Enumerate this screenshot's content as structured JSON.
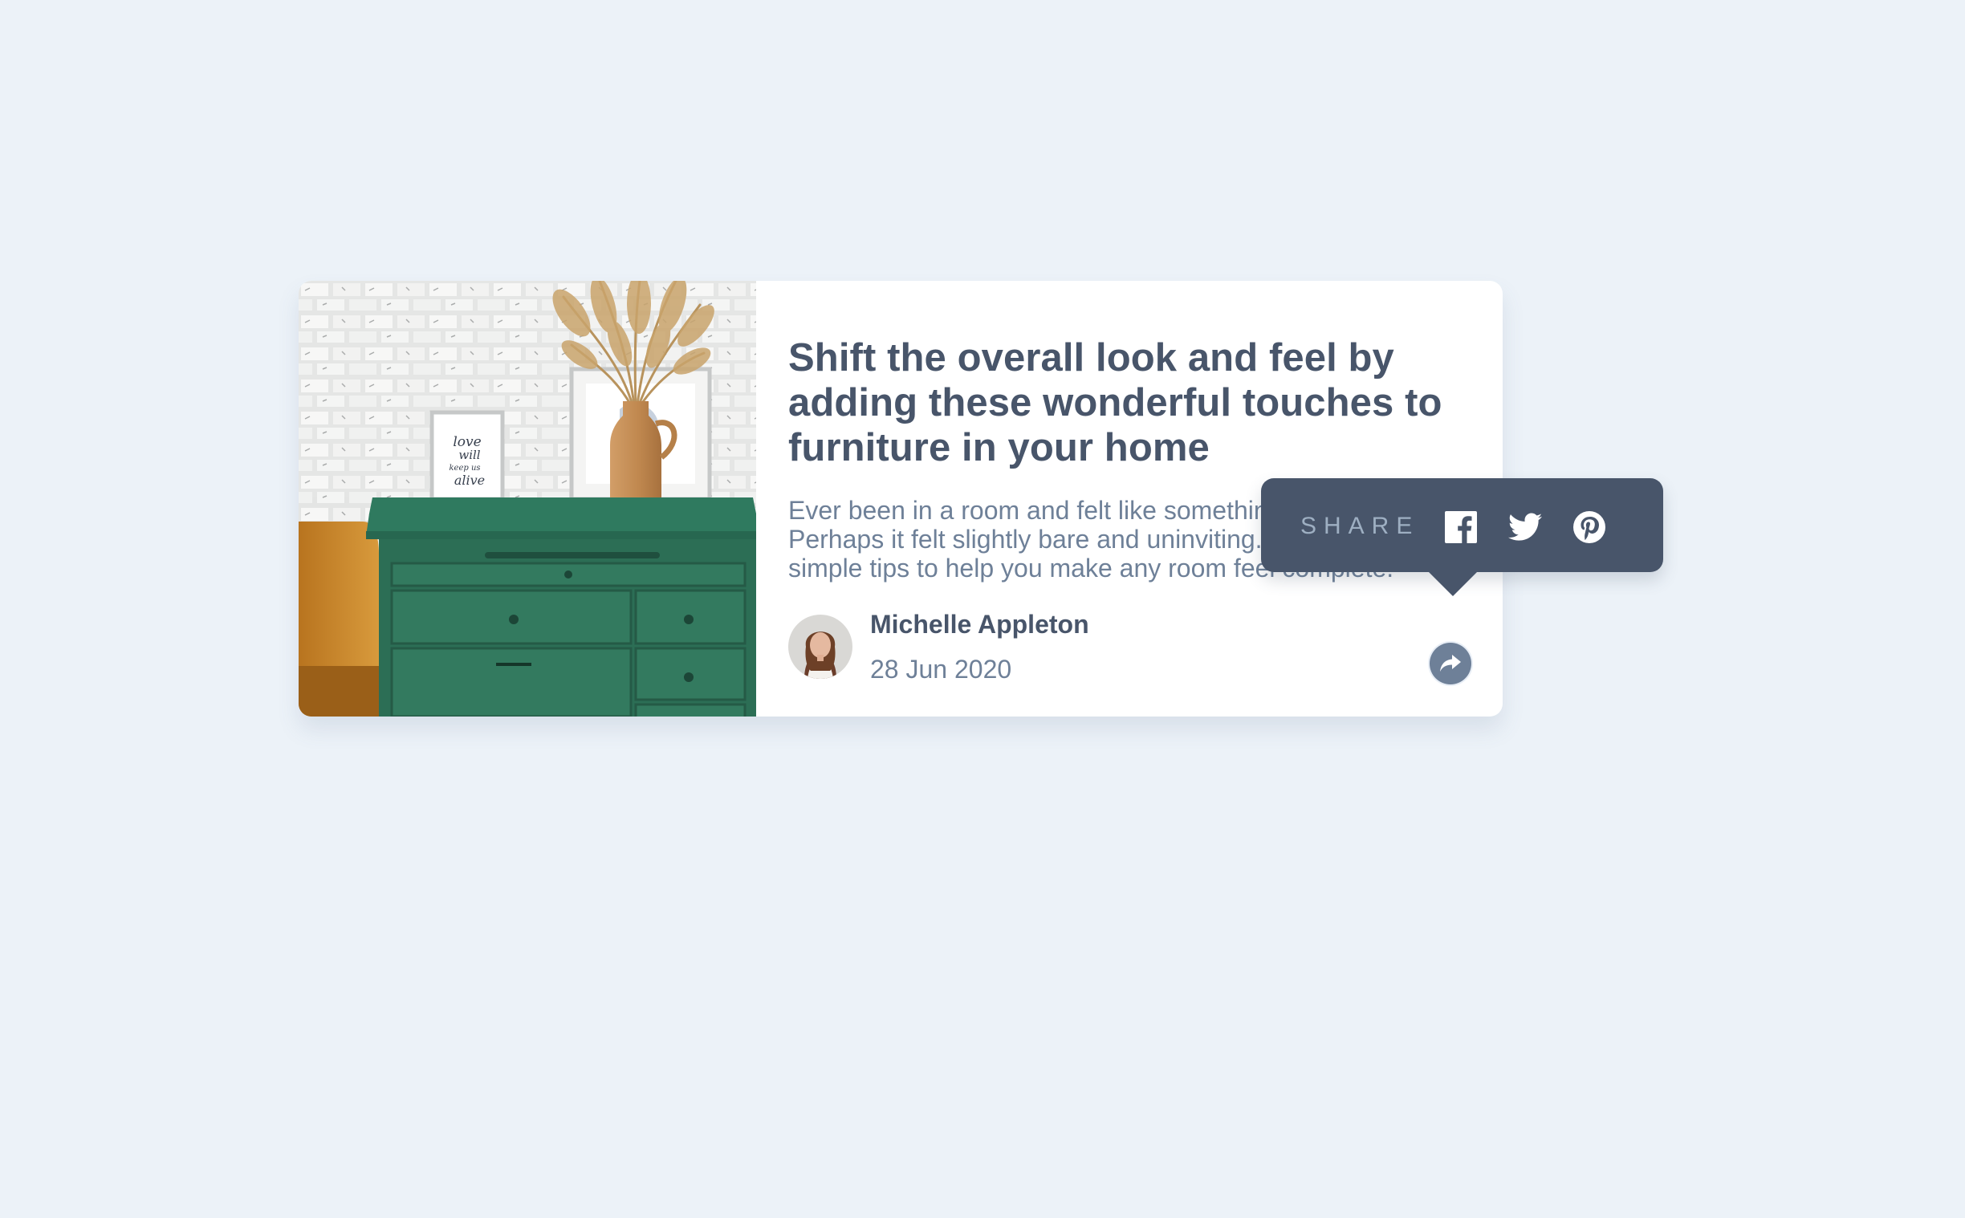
{
  "article": {
    "title": "Shift the overall look and feel by adding these wonderful touches to furniture in your home",
    "excerpt": "Ever been in a room and felt like something was missing? Perhaps it felt slightly bare and uninviting. I’ve got some simple tips to help you make any room feel complete.",
    "image_text": "love will keep us alive"
  },
  "author": {
    "name": "Michelle Appleton",
    "date": "28 Jun 2020"
  },
  "share": {
    "label": "SHARE",
    "icons": [
      "facebook-icon",
      "twitter-icon",
      "pinterest-icon"
    ],
    "button_icon": "share-icon"
  },
  "colors": {
    "background": "#ecf2f8",
    "card": "#ffffff",
    "title_text": "#48556a",
    "body_text": "#6e8098",
    "tooltip_background": "#48556a",
    "share_label": "#9eafc2"
  }
}
